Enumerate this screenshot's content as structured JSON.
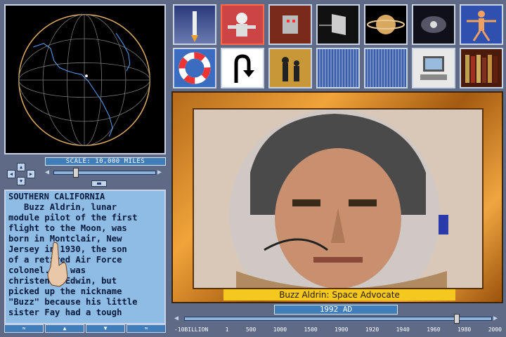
{
  "globe": {
    "scale_label": "SCALE: 10,000 MILES"
  },
  "text_panel": {
    "region": "SOUTHERN CALIFORNIA",
    "body": "   Buzz Aldrin, lunar\nmodule pilot of the first\nflight to the Moon, was\nborn in Montclair, New\nJersey in 1930, the son\nof a retired Air Force\ncolonel. He was\nchristened Edwin, but\npicked up the nickname\n\"Buzz\" because his little\nsister Fay had a tough"
  },
  "scroll_buttons": [
    "≈",
    "▲",
    "▼",
    "≈"
  ],
  "icons_row1": [
    {
      "name": "rocket-launch-icon",
      "active": false
    },
    {
      "name": "astronaut-spacewalk-icon",
      "active": true
    },
    {
      "name": "robot-icon",
      "active": false
    },
    {
      "name": "prism-light-icon",
      "active": false
    },
    {
      "name": "saturn-icon",
      "active": false
    },
    {
      "name": "galaxy-icon",
      "active": false
    },
    {
      "name": "vitruvian-man-icon",
      "active": false
    }
  ],
  "icons_row2": [
    {
      "name": "life-preserver-icon",
      "active": false
    },
    {
      "name": "u-turn-arrow-icon",
      "active": false
    },
    {
      "name": "chess-pieces-icon",
      "active": false
    },
    {
      "name": "empty-slot-icon",
      "active": false
    },
    {
      "name": "empty-slot-icon",
      "active": false
    },
    {
      "name": "computer-icon",
      "active": false
    },
    {
      "name": "bookshelf-icon",
      "active": false
    }
  ],
  "photo": {
    "caption": "Buzz Aldrin: Space Advocate"
  },
  "timeline": {
    "year_label": "1992 AD",
    "ticks": [
      "-10BILLION",
      "1",
      "500",
      "1000",
      "1500",
      "1900",
      "1920",
      "1940",
      "1960",
      "1980",
      "2000"
    ]
  },
  "colors": {
    "background": "#5e6a86",
    "panel_blue": "#3f7dbb",
    "text_panel": "#8fbce4",
    "frame_gold": "#f1a43a",
    "caption_yellow": "#f4c81f"
  }
}
